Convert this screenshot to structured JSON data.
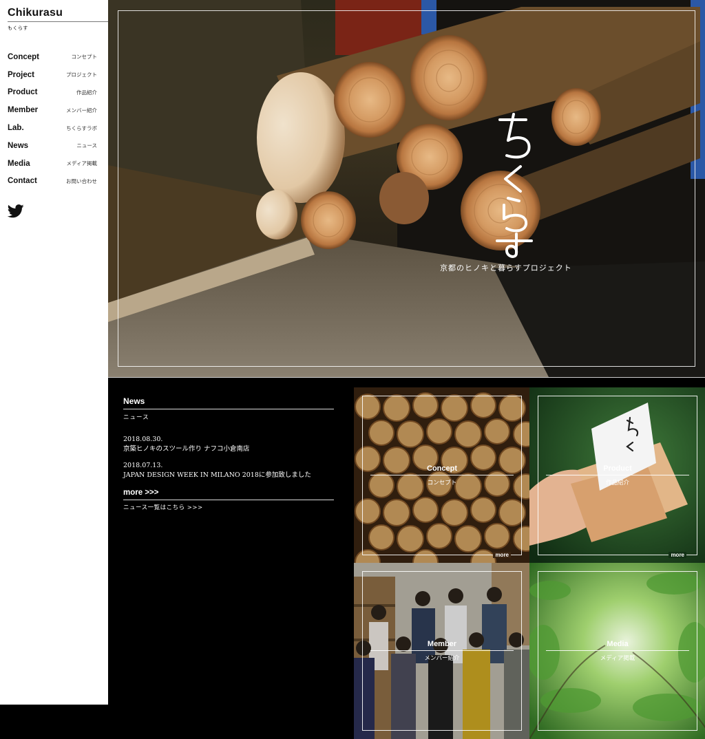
{
  "sidebar": {
    "brand": {
      "title": "Chikurasu",
      "subtitle": "もくらす"
    },
    "nav": [
      {
        "en": "Concept",
        "jp": "コンセプト"
      },
      {
        "en": "Project",
        "jp": "プロジェクト"
      },
      {
        "en": "Product",
        "jp": "作品紹介"
      },
      {
        "en": "Member",
        "jp": "メンバー紹介"
      },
      {
        "en": "Lab.",
        "jp": "ちくらすラボ"
      },
      {
        "en": "News",
        "jp": "ニュース"
      },
      {
        "en": "Media",
        "jp": "メディア掲載"
      },
      {
        "en": "Contact",
        "jp": "お問い合わせ"
      }
    ],
    "social_icon": "twitter-icon"
  },
  "hero": {
    "logo_text": "ちくらす",
    "tagline": "京都のヒノキと暮らすプロジェクト"
  },
  "news": {
    "heading": "News",
    "subheading": "ニュース",
    "items": [
      {
        "date": "2018.08.30.",
        "title": "京築ヒノキのスツール作り ナフコ小倉南店"
      },
      {
        "date": "2018.07.13.",
        "title": "JAPAN DESIGN WEEK IN MILANO 2018に参加致しました"
      }
    ],
    "more_label": "more >>>",
    "more_sub": "ニュース一覧はこちら >>>"
  },
  "tiles": {
    "concept": {
      "en": "Concept",
      "jp": "コンセプト",
      "more": "more"
    },
    "product": {
      "en": "Product",
      "jp": "作品紹介",
      "more": "more"
    },
    "member": {
      "en": "Member",
      "jp": "メンバー紹介"
    },
    "media": {
      "en": "Media",
      "jp": "メディア掲載"
    }
  },
  "colors": {
    "sidebar_bg": "#ffffff",
    "page_bg": "#000000",
    "text_light": "#ffffff",
    "text_dark": "#111111"
  }
}
